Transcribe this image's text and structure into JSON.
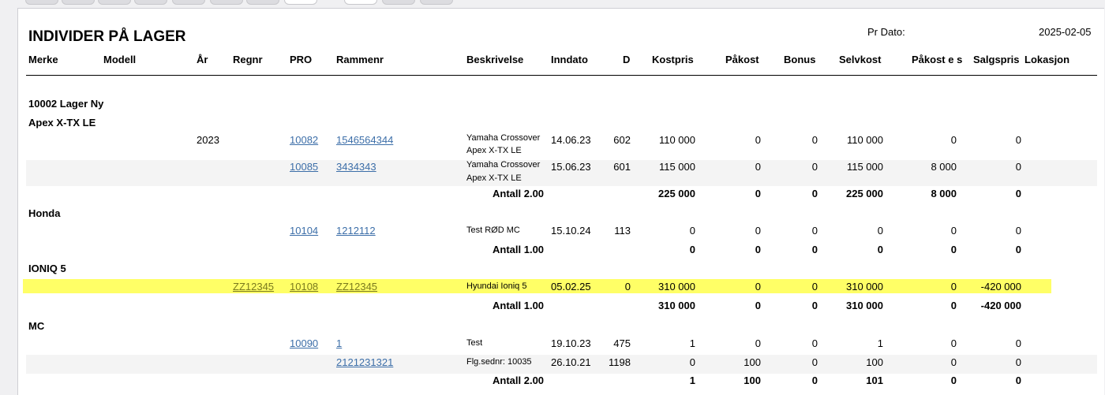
{
  "report": {
    "title": "INDIVIDER PÅ LAGER",
    "date_label": "Pr Dato:",
    "date_value": "2025-02-05"
  },
  "columns": [
    "Merke",
    "Modell",
    "År",
    "Regnr",
    "PRO",
    "Rammenr",
    "Beskrivelse",
    "Inndato",
    "D",
    "Kostpris",
    "Påkost",
    "Bonus",
    "Selvkost",
    "Påkost e s",
    "Salgspris",
    "Lokasjon"
  ],
  "groups": [
    {
      "label": "10002 Lager Ny"
    },
    {
      "label": "Apex X-TX LE"
    },
    {
      "label": "Honda"
    },
    {
      "label": "IONIQ 5"
    },
    {
      "label": "MC"
    }
  ],
  "rows": [
    {
      "year": "2023",
      "regnr": "",
      "pro": "10082",
      "rammenr": "1546564344",
      "desc1": "Yamaha Crossover",
      "desc2": "Apex X-TX LE",
      "inndato": "14.06.23",
      "d": "602",
      "kostpris": "110 000",
      "pakost": "0",
      "bonus": "0",
      "selvkost": "110 000",
      "pakost_es": "0",
      "salgspris": "0"
    },
    {
      "year": "",
      "regnr": "",
      "pro": "10085",
      "rammenr": "3434343",
      "desc1": "Yamaha Crossover",
      "desc2": "Apex X-TX LE",
      "inndato": "15.06.23",
      "d": "601",
      "kostpris": "115 000",
      "pakost": "0",
      "bonus": "0",
      "selvkost": "115 000",
      "pakost_es": "8 000",
      "salgspris": "0"
    },
    {
      "year": "",
      "regnr": "",
      "pro": "10104",
      "rammenr": "1212112",
      "desc1": "Test RØD MC",
      "desc2": "",
      "inndato": "15.10.24",
      "d": "113",
      "kostpris": "0",
      "pakost": "0",
      "bonus": "0",
      "selvkost": "0",
      "pakost_es": "0",
      "salgspris": "0"
    },
    {
      "year": "",
      "regnr": "ZZ12345",
      "pro": "10108",
      "rammenr": "ZZ12345",
      "desc1": "Hyundai Ioniq 5",
      "desc2": "",
      "inndato": "05.02.25",
      "d": "0",
      "kostpris": "310 000",
      "pakost": "0",
      "bonus": "0",
      "selvkost": "310 000",
      "pakost_es": "0",
      "salgspris": "-420 000"
    },
    {
      "year": "",
      "regnr": "",
      "pro": "10090",
      "rammenr": "1",
      "desc1": "Test",
      "desc2": "",
      "inndato": "19.10.23",
      "d": "475",
      "kostpris": "1",
      "pakost": "0",
      "bonus": "0",
      "selvkost": "1",
      "pakost_es": "0",
      "salgspris": "0"
    },
    {
      "year": "",
      "regnr": "",
      "pro": "",
      "rammenr": "2121231321",
      "desc1": "Flg.sednr: 10035",
      "desc2": "",
      "inndato": "26.10.21",
      "d": "1198",
      "kostpris": "0",
      "pakost": "100",
      "bonus": "0",
      "selvkost": "100",
      "pakost_es": "0",
      "salgspris": "0"
    }
  ],
  "totals": [
    {
      "label": "Antall 2.00",
      "kostpris": "225 000",
      "pakost": "0",
      "bonus": "0",
      "selvkost": "225 000",
      "pakost_es": "8 000",
      "salgspris": "0"
    },
    {
      "label": "Antall 1.00",
      "kostpris": "0",
      "pakost": "0",
      "bonus": "0",
      "selvkost": "0",
      "pakost_es": "0",
      "salgspris": "0"
    },
    {
      "label": "Antall 1.00",
      "kostpris": "310 000",
      "pakost": "0",
      "bonus": "0",
      "selvkost": "310 000",
      "pakost_es": "0",
      "salgspris": "-420 000"
    },
    {
      "label": "Antall 2.00",
      "kostpris": "1",
      "pakost": "100",
      "bonus": "0",
      "selvkost": "101",
      "pakost_es": "0",
      "salgspris": "0"
    }
  ],
  "colors": {
    "highlight": "#ffff66",
    "link": "#3c6ea8",
    "band": "#f4f4f4"
  }
}
